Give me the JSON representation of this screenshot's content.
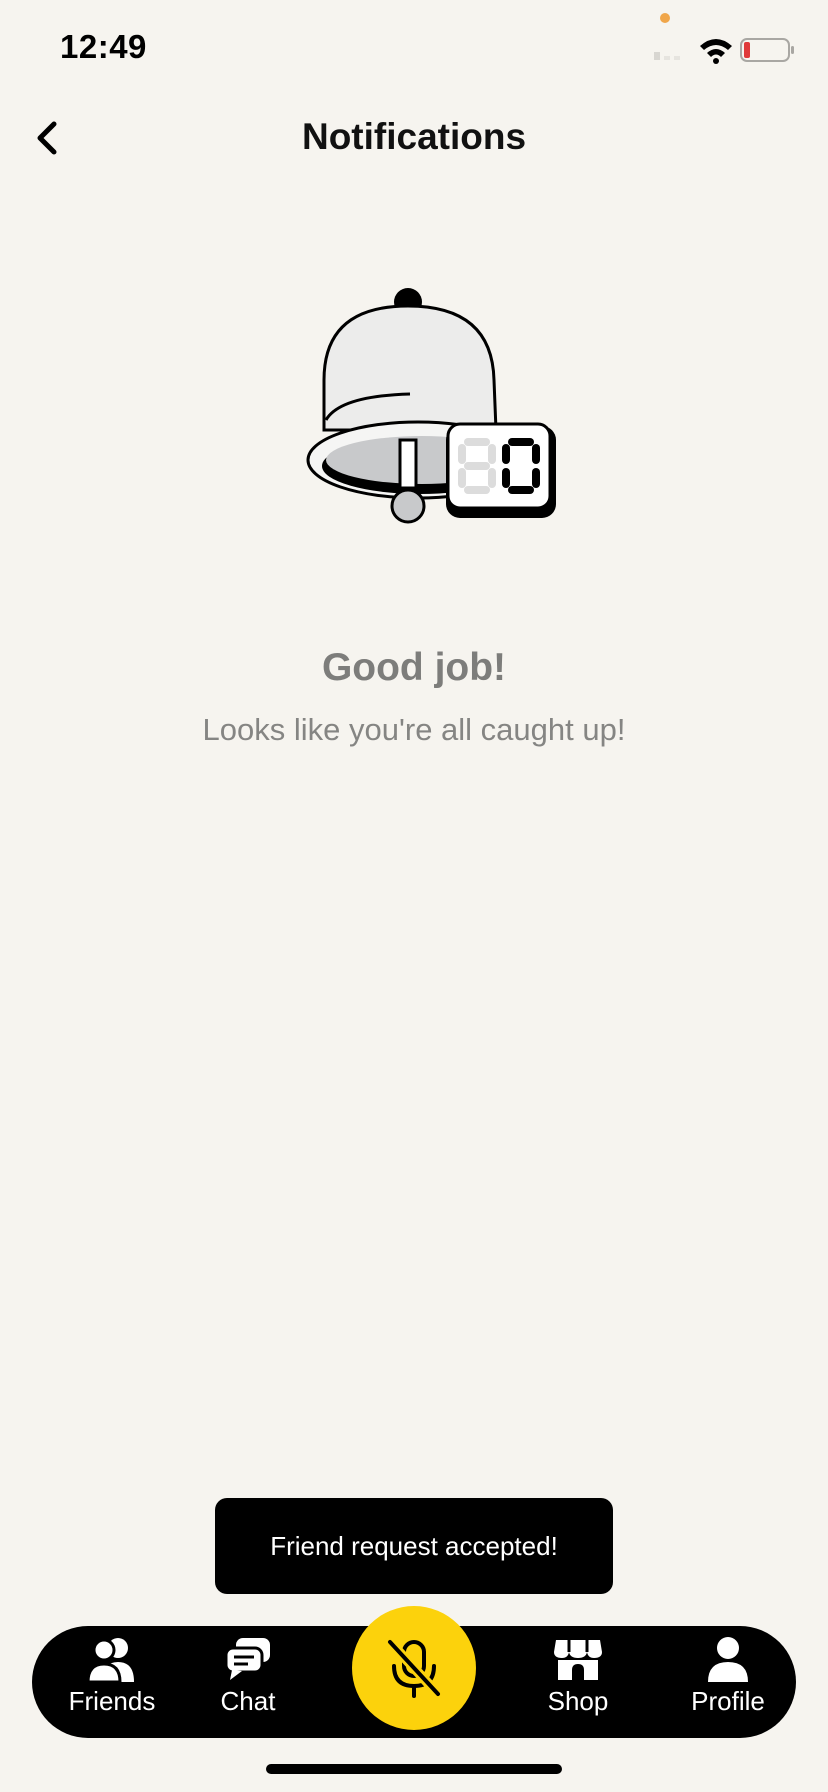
{
  "status_bar": {
    "time": "12:49"
  },
  "header": {
    "title": "Notifications"
  },
  "illustration": {
    "counter_value": "0"
  },
  "empty_state": {
    "title": "Good job!",
    "subtitle": "Looks like you're all caught up!"
  },
  "toast": {
    "message": "Friend request accepted!"
  },
  "tab_bar": {
    "items": [
      {
        "label": "Friends",
        "icon": "friends-icon"
      },
      {
        "label": "Chat",
        "icon": "chat-icon"
      },
      {
        "label": "Shop",
        "icon": "shop-icon"
      },
      {
        "label": "Profile",
        "icon": "profile-icon"
      }
    ],
    "mic": {
      "icon": "mic-muted-icon",
      "color": "#fcd20c"
    }
  },
  "colors": {
    "background": "#f6f4ef",
    "accent": "#fcd20c",
    "battery_low": "#e03a3a"
  }
}
